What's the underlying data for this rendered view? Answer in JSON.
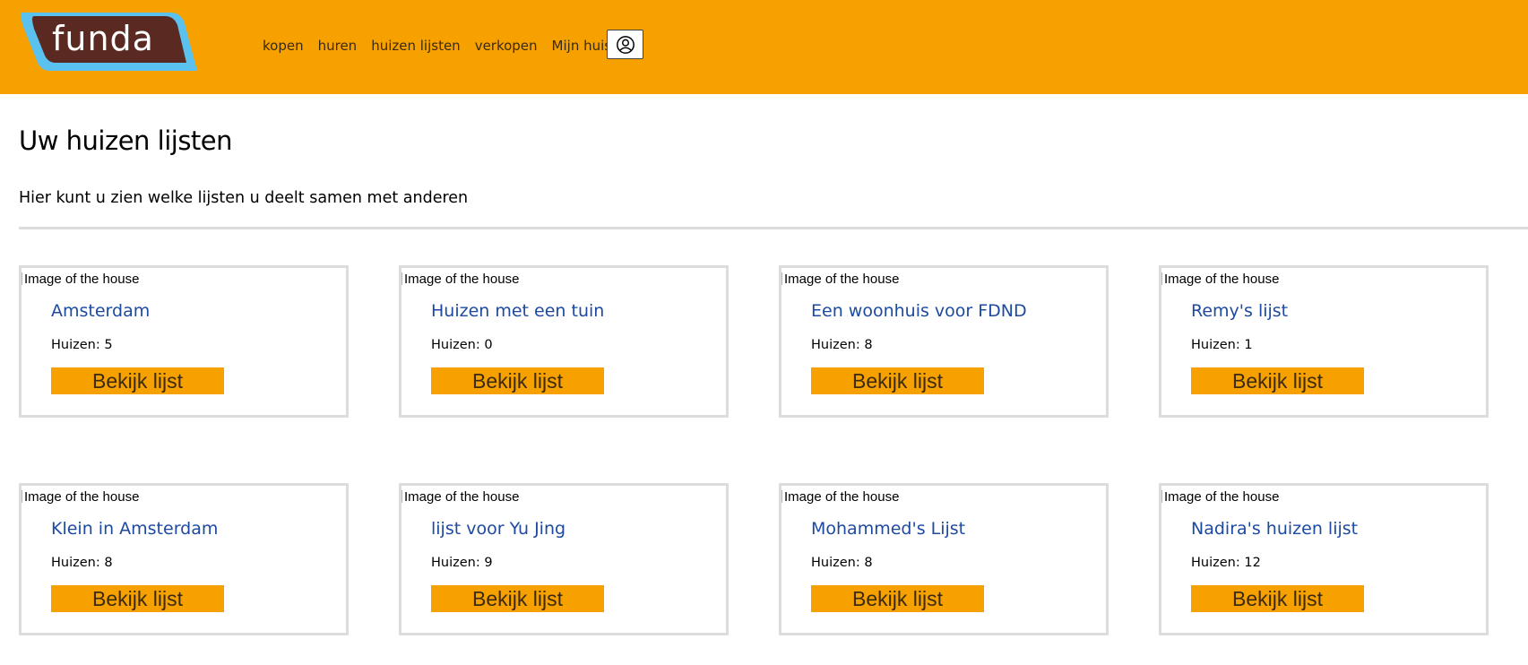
{
  "app": {
    "logo_text": "funda",
    "brand_color": "#f7a100",
    "logo_colors": {
      "outline": "#5bc2ef",
      "fill": "#5a2a22",
      "text": "#ffffff"
    }
  },
  "nav": {
    "items": [
      {
        "label": "kopen"
      },
      {
        "label": "huren"
      },
      {
        "label": "huizen lijsten"
      },
      {
        "label": "verkopen"
      },
      {
        "label": "Mijn huis"
      }
    ],
    "account_icon": "user-circle-icon"
  },
  "page": {
    "title": "Uw huizen lijsten",
    "intro": "Hier kunt u zien welke lijsten u deelt samen met anderen"
  },
  "lists": [
    {
      "image_alt": "Image of the house",
      "name": "Amsterdam",
      "count_label": "Huizen: 5",
      "button_label": "Bekijk lijst"
    },
    {
      "image_alt": "Image of the house",
      "name": "Huizen met een tuin",
      "count_label": "Huizen: 0",
      "button_label": "Bekijk lijst"
    },
    {
      "image_alt": "Image of the house",
      "name": "Een woonhuis voor FDND",
      "count_label": "Huizen: 8",
      "button_label": "Bekijk lijst"
    },
    {
      "image_alt": "Image of the house",
      "name": "Remy's lijst",
      "count_label": "Huizen: 1",
      "button_label": "Bekijk lijst"
    },
    {
      "image_alt": "Image of the house",
      "name": "Klein in Amsterdam",
      "count_label": "Huizen: 8",
      "button_label": "Bekijk lijst"
    },
    {
      "image_alt": "Image of the house",
      "name": "lijst voor Yu Jing",
      "count_label": "Huizen: 9",
      "button_label": "Bekijk lijst"
    },
    {
      "image_alt": "Image of the house",
      "name": "Mohammed's Lijst",
      "count_label": "Huizen: 8",
      "button_label": "Bekijk lijst"
    },
    {
      "image_alt": "Image of the house",
      "name": "Nadira's huizen lijst",
      "count_label": "Huizen: 12",
      "button_label": "Bekijk lijst"
    }
  ]
}
